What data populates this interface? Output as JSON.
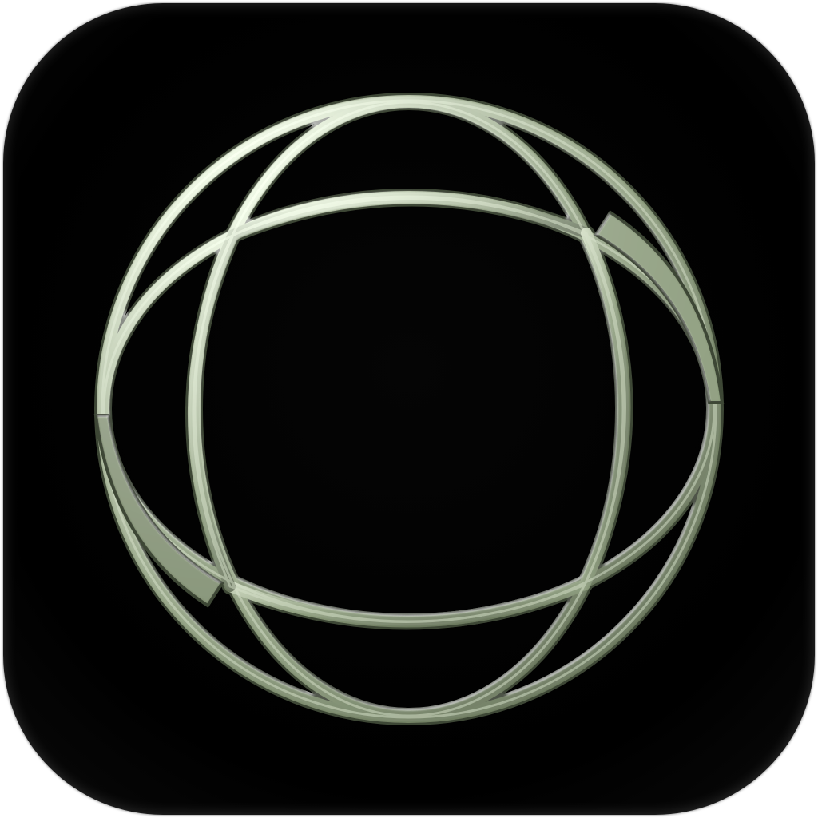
{
  "icon": {
    "name": "globe-wireframe-app-icon",
    "background_color": "#000000",
    "symbol_color": "#8a9a7a",
    "symbol_highlight": "#c4d0b6",
    "symbol_shadow": "#4f5a45"
  }
}
